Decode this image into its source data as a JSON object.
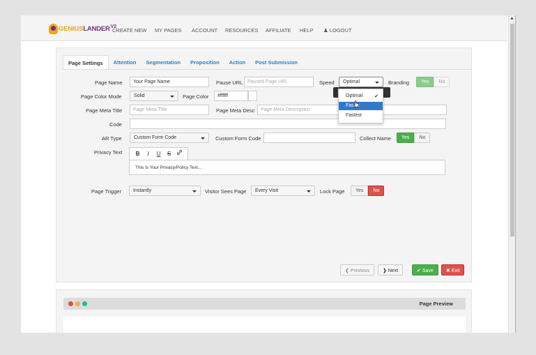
{
  "nav": {
    "logo_part1": "GENIUS",
    "logo_part2": "LANDER",
    "logo_version": "V2",
    "links": [
      "CREATE NEW",
      "MY PAGES",
      "ACCOUNT",
      "RESOURCES",
      "AFFILIATE",
      "HELP",
      "LOGOUT"
    ]
  },
  "tabs": [
    "Page Settings",
    "Attention",
    "Segmentation",
    "Proposition",
    "Action",
    "Post Submission"
  ],
  "form": {
    "page_name_label": "Page Name",
    "page_name_value": "Your Page Name",
    "pause_url_label": "Pause URL",
    "pause_url_placeholder": "Paused Page URL",
    "speed_label": "Speed",
    "speed_value": "Optimal",
    "branding_label": "Branding",
    "branding_yes": "Yes",
    "branding_no": "No",
    "page_color_mode_label": "Page Color Mode",
    "page_color_mode_value": "Solid",
    "page_color_label": "Page Color",
    "page_color_value": "#ffffff",
    "page_meta_title_label": "Page Meta Title",
    "page_meta_title_placeholder": "Page Meta Title",
    "page_meta_desc_label": "Page Meta Desc",
    "page_meta_desc_placeholder": "Page Meta Description",
    "code_label": "Code",
    "ar_type_label": "AR Type",
    "ar_type_value": "Custom Form Code",
    "custom_form_code_label": "Custom Form Code",
    "collect_name_label": "Collect Name",
    "collect_name_yes": "Yes",
    "collect_name_no": "No",
    "privacy_text_label": "Privacy Text",
    "privacy_text_value": "This Is Your Privacy/Policy Text...",
    "page_trigger_label": "Page Trigger",
    "page_trigger_value": "Instantly",
    "visitor_sees_page_label": "Visitor Sees Page",
    "visitor_sees_page_value": "Every Visit",
    "lock_page_label": "Lock Page",
    "lock_page_yes": "Yes",
    "lock_page_no": "No"
  },
  "speed_dropdown": {
    "options": [
      "Optimal",
      "Faster",
      "Fastest"
    ],
    "selected": "Optimal",
    "highlighted": "Faster"
  },
  "editor_tools": [
    "B",
    "I",
    "U",
    "S",
    "link"
  ],
  "buttons": {
    "previous": "Previous",
    "next": "Next",
    "save": "Save",
    "exit": "Exit"
  },
  "preview": {
    "title": "Page Preview",
    "dot_colors": [
      "#e74c3c",
      "#f0ad4e",
      "#1abc9c"
    ]
  },
  "colors": {
    "tab_link": "#2d7fbf",
    "success": "#4cae4c",
    "danger": "#d9534f",
    "highlight": "#3379c8"
  }
}
